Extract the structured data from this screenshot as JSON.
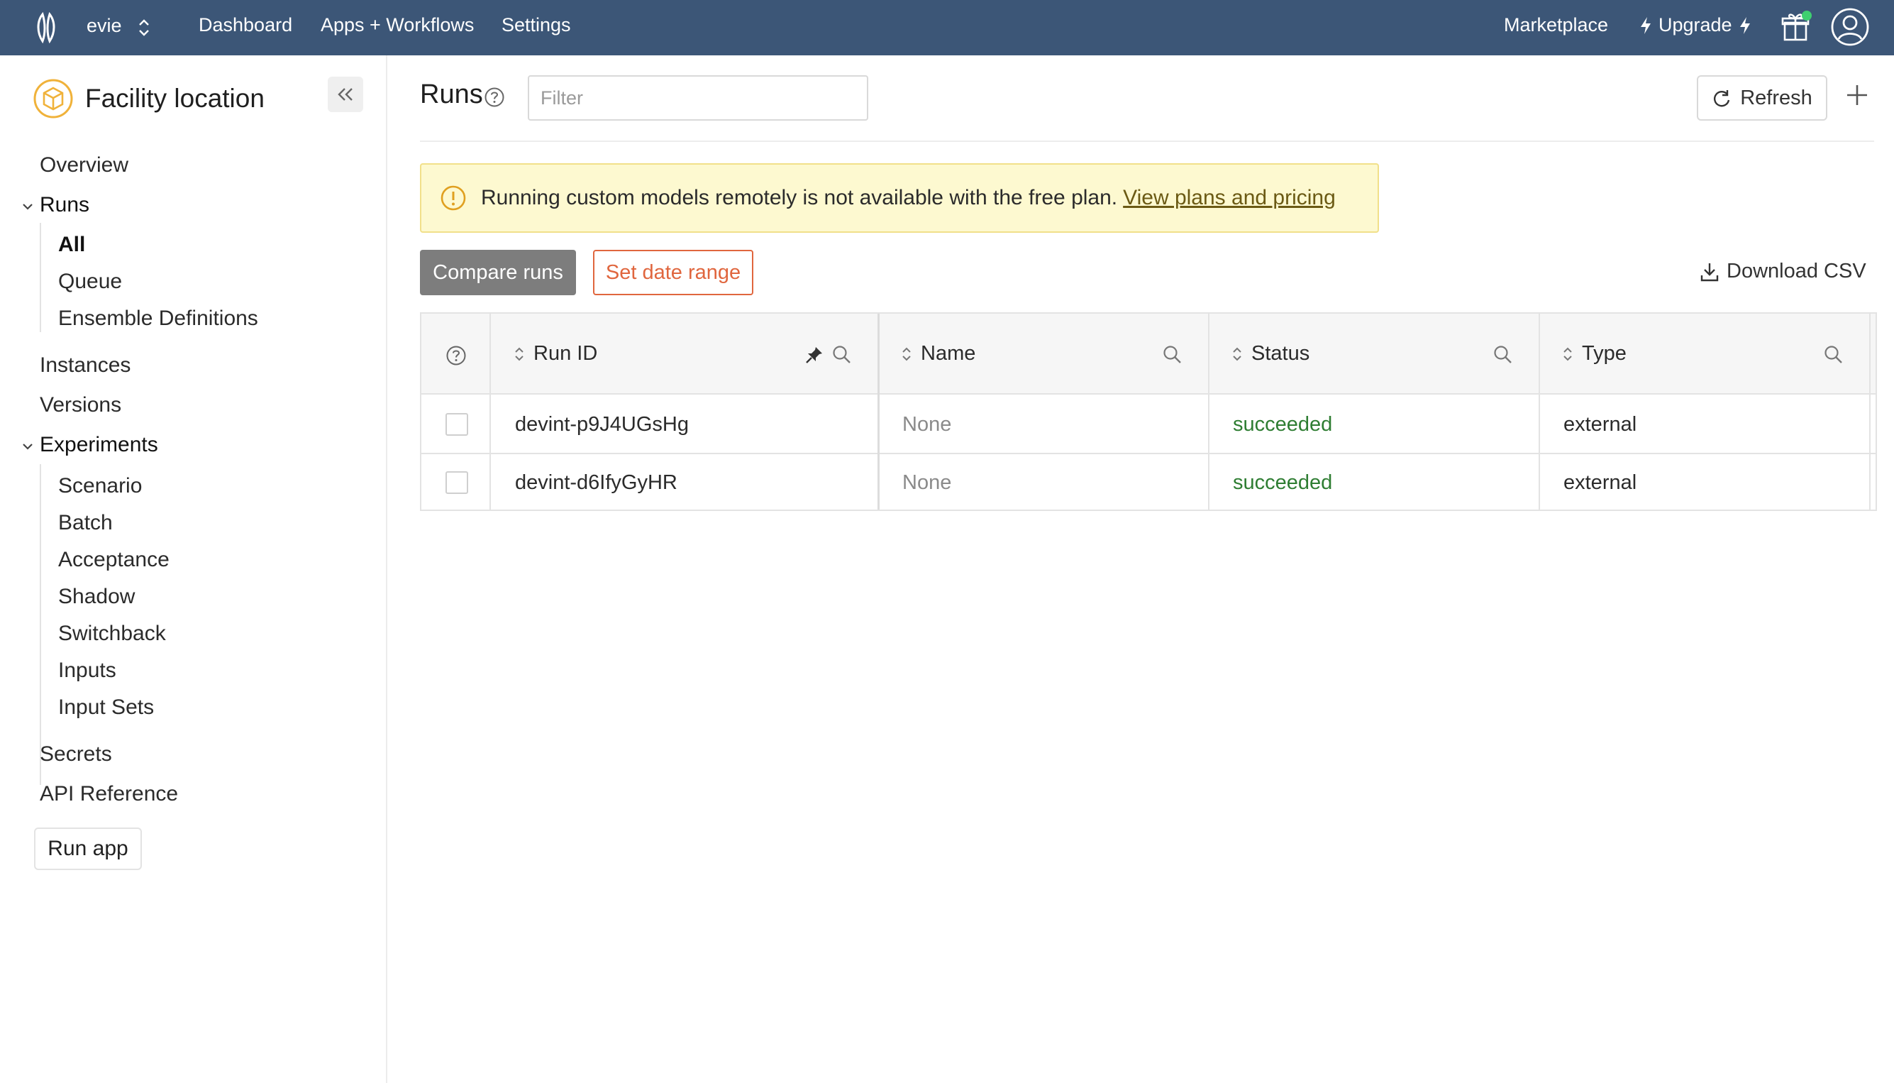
{
  "topbar": {
    "org_name": "evie",
    "nav": [
      "Dashboard",
      "Apps + Workflows",
      "Settings"
    ],
    "marketplace": "Marketplace",
    "upgrade": "Upgrade",
    "gift_dot_color": "#3ecf6f"
  },
  "sidebar": {
    "app_title": "Facility location",
    "overview": "Overview",
    "runs": "Runs",
    "runs_sub": [
      "All",
      "Queue",
      "Ensemble Definitions"
    ],
    "instances": "Instances",
    "versions": "Versions",
    "experiments": "Experiments",
    "experiments_sub": [
      "Scenario",
      "Batch",
      "Acceptance",
      "Shadow",
      "Switchback",
      "Inputs",
      "Input Sets"
    ],
    "secrets": "Secrets",
    "api_reference": "API Reference",
    "run_app": "Run app"
  },
  "main": {
    "title": "Runs",
    "filter_placeholder": "Filter",
    "refresh": "Refresh",
    "banner": {
      "message": "Running custom models remotely is not available with the free plan.",
      "link": "View plans and pricing"
    },
    "compare_runs": "Compare runs",
    "set_date_range": "Set date range",
    "download_csv": "Download CSV"
  },
  "table": {
    "columns": [
      "Run ID",
      "Name",
      "Status",
      "Type"
    ],
    "rows": [
      {
        "run_id": "devint-p9J4UGsHg",
        "name": "None",
        "status": "succeeded",
        "type": "external"
      },
      {
        "run_id": "devint-d6IfyGyHR",
        "name": "None",
        "status": "succeeded",
        "type": "external"
      }
    ]
  },
  "colors": {
    "topbar_bg": "#3c5677",
    "accent_orange": "#e0663e",
    "status_succeeded": "#2e7d32",
    "banner_bg": "#fdf9d0",
    "app_icon": "#f0b23a"
  }
}
